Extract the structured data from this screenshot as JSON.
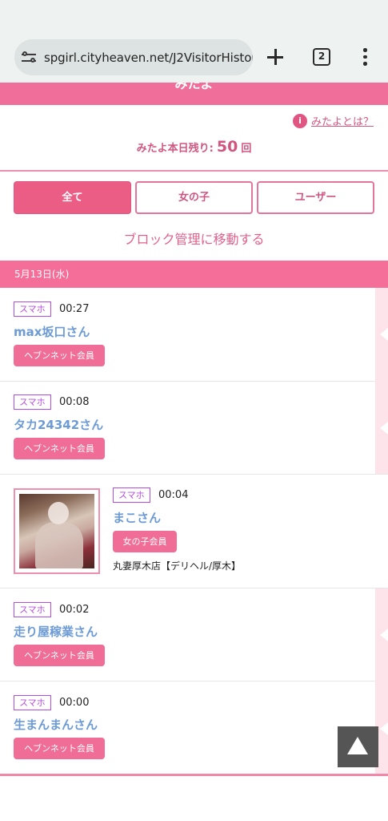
{
  "browser": {
    "url": "spgirl.cityheaven.net/J2VisitorHistor",
    "tab_count": "2"
  },
  "page": {
    "title": "みたよ",
    "help_link": "みたよとは？",
    "info_glyph": "i",
    "remaining_label": "みたよ本日残り:",
    "remaining_count": "50",
    "remaining_unit": "回",
    "filters": [
      "全て",
      "女の子",
      "ユーザー"
    ],
    "block_link": "ブロック管理に移動する",
    "date_header": "5月13日(水)"
  },
  "visitors": [
    {
      "device": "スマホ",
      "time": "00:27",
      "name": "max坂口さん",
      "member_type": "ヘブンネット会員"
    },
    {
      "device": "スマホ",
      "time": "00:08",
      "name": "タカ24342さん",
      "member_type": "ヘブンネット会員"
    },
    {
      "device": "スマホ",
      "time": "00:04",
      "name": "まこさん",
      "member_type": "女の子会員",
      "shop": "丸妻厚木店【デリヘル/厚木】",
      "has_photo": true
    },
    {
      "device": "スマホ",
      "time": "00:02",
      "name": "走り屋稼業さん",
      "member_type": "ヘブンネット会員"
    },
    {
      "device": "スマホ",
      "time": "00:00",
      "name": "生まんまんさん",
      "member_type": "ヘブンネット会員"
    }
  ],
  "colors": {
    "accent_pink": "#f06f9a",
    "link_pink": "#d25a82",
    "name_blue": "#6d9bd5",
    "badge_purple": "#b54ee0",
    "back_to_top_gray": "#555555"
  },
  "icons": [
    "tune-icon",
    "plus-icon",
    "tabs-icon",
    "menu-icon",
    "info-icon",
    "arrow-up-icon"
  ]
}
